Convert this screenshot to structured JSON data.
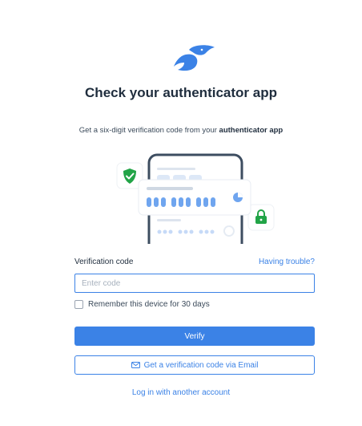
{
  "title": "Check your authenticator app",
  "subtitle": {
    "prefix": "Get a six-digit verification code from your ",
    "bold": "authenticator app"
  },
  "form": {
    "label": "Verification code",
    "trouble_link": "Having trouble?",
    "placeholder": "Enter code",
    "value": "",
    "remember_label": "Remember this device for 30 days",
    "remember_checked": false
  },
  "buttons": {
    "verify": "Verify",
    "email": "Get a verification code via Email"
  },
  "alt_login": "Log in with another account",
  "icons": {
    "logo": "brand-logo-icon",
    "shield": "shield-check-icon",
    "lock": "lock-icon",
    "mail": "mail-icon",
    "pie": "timer-pie-icon"
  },
  "colors": {
    "accent": "#3b82e6",
    "text": "#1f2d3d",
    "shield": "#22a447",
    "phone_frame": "#3d4d60"
  }
}
